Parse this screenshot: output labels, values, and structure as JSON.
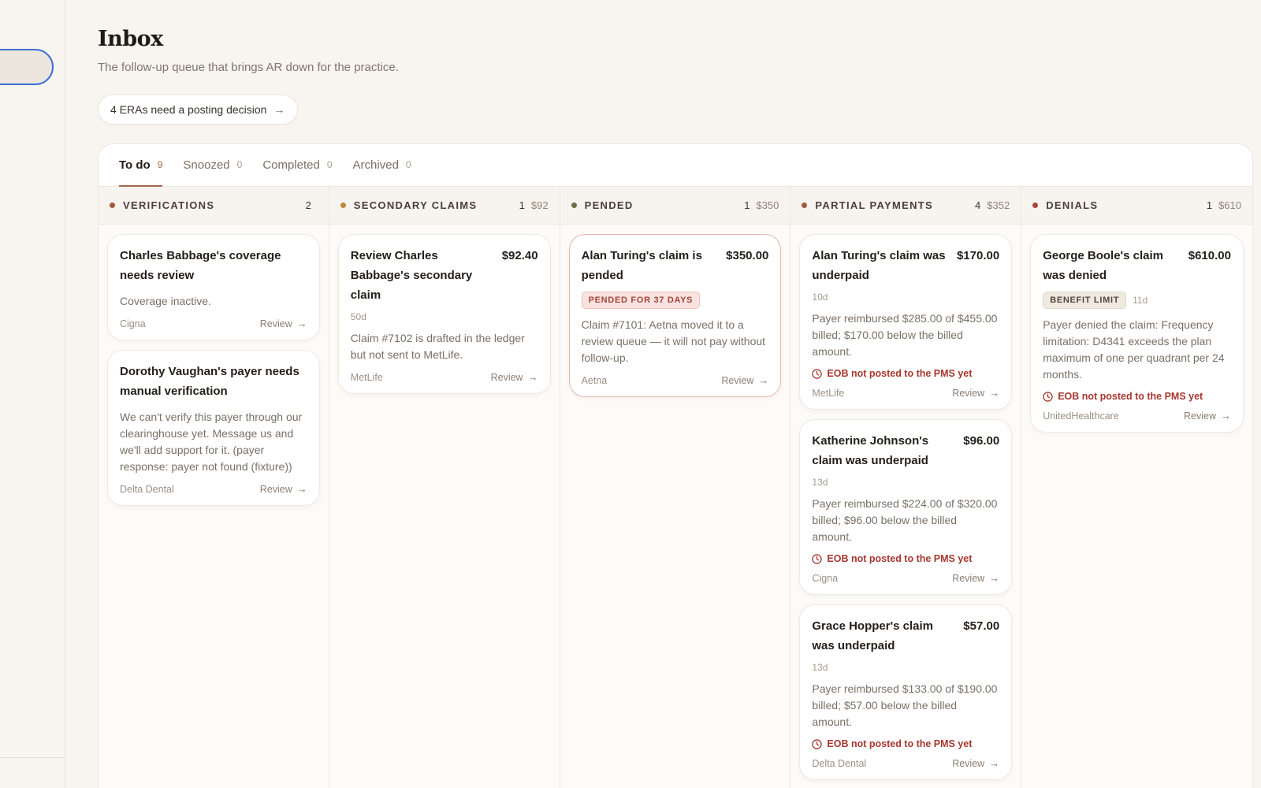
{
  "page": {
    "title": "Inbox",
    "subtitle": "The follow-up queue that brings AR down for the practice.",
    "era_pill": {
      "label": "4 ERAs need a posting decision",
      "icon": "arrow-right-icon"
    }
  },
  "tabs": [
    {
      "label": "To do",
      "count": "9",
      "active": true
    },
    {
      "label": "Snoozed",
      "count": "0"
    },
    {
      "label": "Completed",
      "count": "0"
    },
    {
      "label": "Archived",
      "count": "0"
    }
  ],
  "colors": {
    "accent": "#a4684a",
    "sidebar_focus": "#3d6fd6",
    "eob_warning": "#a5382f"
  },
  "columns": [
    {
      "title": "VERIFICATIONS",
      "count": "2",
      "sum": "",
      "dot_color": "#a05a3c",
      "cards": [
        {
          "title": "Charles Babbage's coverage needs review",
          "amount": "",
          "body": "Coverage inactive.",
          "payer": "Cigna",
          "action": "Review"
        },
        {
          "title": "Dorothy Vaughan's payer needs manual verification",
          "amount": "",
          "body": "We can't verify this payer through our clearinghouse yet. Message us and we'll add support for it. (payer response: payer not found (fixture))",
          "payer": "Delta Dental",
          "action": "Review"
        }
      ]
    },
    {
      "title": "SECONDARY CLAIMS",
      "count": "1",
      "sum": "$92",
      "dot_color": "#c0893a",
      "cards": [
        {
          "title": "Review Charles Babbage's secondary claim",
          "amount": "$92.40",
          "age": "50d",
          "body": "Claim #7102 is drafted in the ledger but not sent to MetLife.",
          "payer": "MetLife",
          "action": "Review"
        }
      ]
    },
    {
      "title": "PENDED",
      "count": "1",
      "sum": "$350",
      "dot_color": "#6f6a48",
      "cards": [
        {
          "title": "Alan Turing's claim is pended",
          "amount": "$350.00",
          "tag": "PENDED FOR 37 DAYS",
          "body": "Claim #7101: Aetna moved it to a review queue — it will not pay without follow-up.",
          "payer": "Aetna",
          "action": "Review"
        }
      ]
    },
    {
      "title": "PARTIAL PAYMENTS",
      "count": "4",
      "sum": "$352",
      "dot_color": "#a05a3c",
      "cards": [
        {
          "title": "Alan Turing's claim was underpaid",
          "amount": "$170.00",
          "age": "10d",
          "body": "Payer reimbursed $285.00 of $455.00 billed; $170.00 below the billed amount.",
          "eob": "EOB not posted to the PMS yet",
          "payer": "MetLife",
          "action": "Review"
        },
        {
          "title": "Katherine Johnson's claim was underpaid",
          "amount": "$96.00",
          "age": "13d",
          "body": "Payer reimbursed $224.00 of $320.00 billed; $96.00 below the billed amount.",
          "eob": "EOB not posted to the PMS yet",
          "payer": "Cigna",
          "action": "Review"
        },
        {
          "title": "Grace Hopper's claim was underpaid",
          "amount": "$57.00",
          "age": "13d",
          "body": "Payer reimbursed $133.00 of $190.00 billed; $57.00 below the billed amount.",
          "eob": "EOB not posted to the PMS yet",
          "payer": "Delta Dental",
          "action": "Review"
        }
      ]
    },
    {
      "title": "DENIALS",
      "count": "1",
      "sum": "$610",
      "dot_color": "#a8473e",
      "cards": [
        {
          "title": "George Boole's claim was denied",
          "amount": "$610.00",
          "tag": "BENEFIT LIMIT",
          "age": "11d",
          "body": "Payer denied the claim: Frequency limitation: D4341 exceeds the plan maximum of one per quadrant per 24 months.",
          "eob": "EOB not posted to the PMS yet",
          "payer": "UnitedHealthcare",
          "action": "Review"
        }
      ]
    }
  ]
}
